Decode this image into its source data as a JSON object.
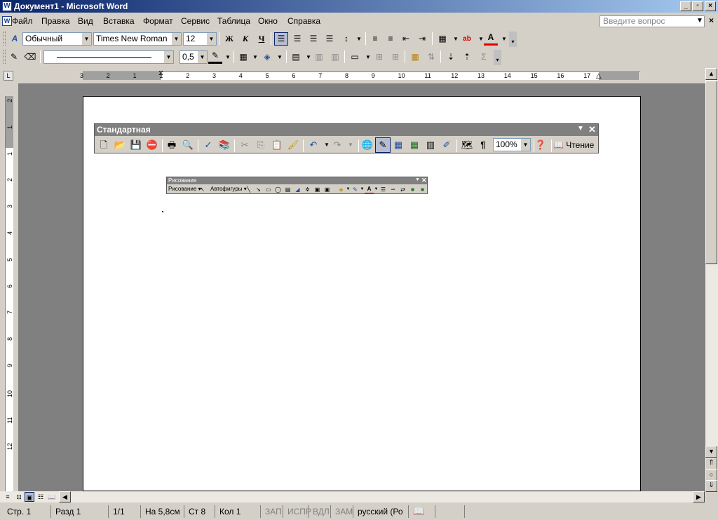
{
  "title_bar": {
    "app_icon": "word-document-icon",
    "title": "Документ1 - Microsoft Word",
    "controls": [
      "_",
      "▫",
      "×"
    ]
  },
  "menu_bar": {
    "items": [
      "Файл",
      "Правка",
      "Вид",
      "Вставка",
      "Формат",
      "Сервис",
      "Таблица",
      "Окно",
      "Справка"
    ],
    "help_placeholder": "Введите вопрос",
    "doc_close": "×"
  },
  "formatting_toolbar": {
    "style_value": "Обычный",
    "font_value": "Times New Roman",
    "size_value": "12",
    "bold": "Ж",
    "italic": "К",
    "underline": "Ч",
    "icons": [
      "styles-icon",
      "align-left-icon",
      "align-center-icon",
      "align-right-icon",
      "justify-icon",
      "line-spacing-icon",
      "numbering-icon",
      "bullets-icon",
      "decrease-indent-icon",
      "increase-indent-icon",
      "borders-icon",
      "highlight-icon",
      "font-color-icon"
    ]
  },
  "tables_toolbar": {
    "line_weight": "0,5",
    "autosum": "Σ"
  },
  "ruler": {
    "labels": [
      "3",
      "2",
      "1",
      "1",
      "2",
      "3",
      "4",
      "5",
      "6",
      "7",
      "8",
      "9",
      "10",
      "11",
      "12",
      "13",
      "14",
      "15",
      "16",
      "17"
    ]
  },
  "vertical_ruler": {
    "labels": [
      "2",
      "1",
      "1",
      "2",
      "3",
      "4",
      "5",
      "6",
      "7",
      "8",
      "9",
      "10",
      "11",
      "12"
    ]
  },
  "standard_toolbar": {
    "title": "Стандартная",
    "zoom": "100%",
    "pilcrow": "¶",
    "read_label": "Чтение"
  },
  "drawing_toolbar": {
    "title": "Рисование",
    "draw_menu": "Рисование",
    "autoshapes": "Автофигуры"
  },
  "status_bar": {
    "page": "Стр. 1",
    "section": "Разд 1",
    "pages": "1/1",
    "position": "На 5,8см",
    "line": "Ст 8",
    "column": "Кол 1",
    "rec": "ЗАП",
    "trk": "ИСПР",
    "ext": "ВДЛ",
    "ovr": "ЗАМ",
    "language": "русский (Ро"
  },
  "colors": {
    "title_gradient_start": "#0a246a",
    "title_gradient_end": "#a6caf0",
    "workspace": "#808080",
    "chrome": "#d4d0c8"
  }
}
